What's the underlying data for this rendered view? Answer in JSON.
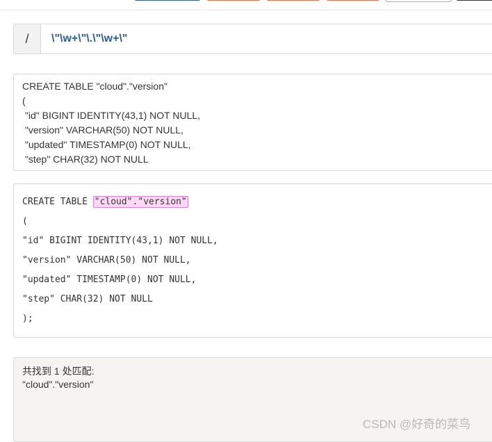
{
  "regex": {
    "delimiter": "/",
    "pattern": "\\\"\\w+\\\"\\.\\\"\\w+\\\""
  },
  "source": {
    "lines": [
      "CREATE TABLE \"cloud\".\"version\"",
      "(",
      " \"id\" BIGINT IDENTITY(43,1) NOT NULL,",
      " \"version\" VARCHAR(50) NOT NULL,",
      " \"updated\" TIMESTAMP(0) NOT NULL,",
      " \"step\" CHAR(32) NOT NULL"
    ]
  },
  "highlight": {
    "line1_prefix": "CREATE TABLE ",
    "line1_match": "\"cloud\".\"version\"",
    "lines": [
      "(",
      "\"id\" BIGINT IDENTITY(43,1) NOT NULL,",
      "\"version\" VARCHAR(50) NOT NULL,",
      "\"updated\" TIMESTAMP(0) NOT NULL,",
      "\"step\" CHAR(32) NOT NULL",
      ");"
    ]
  },
  "result": {
    "summary": "共找到 1 处匹配:",
    "matches": [
      "\"cloud\".\"version\""
    ]
  },
  "watermark": "CSDN @好奇的菜鸟",
  "colors": {
    "accent_blue": "#2b5e93",
    "match_bg": "#ffd9f5",
    "match_border": "#e67fd0",
    "result_bg": "#f5f4f0"
  }
}
